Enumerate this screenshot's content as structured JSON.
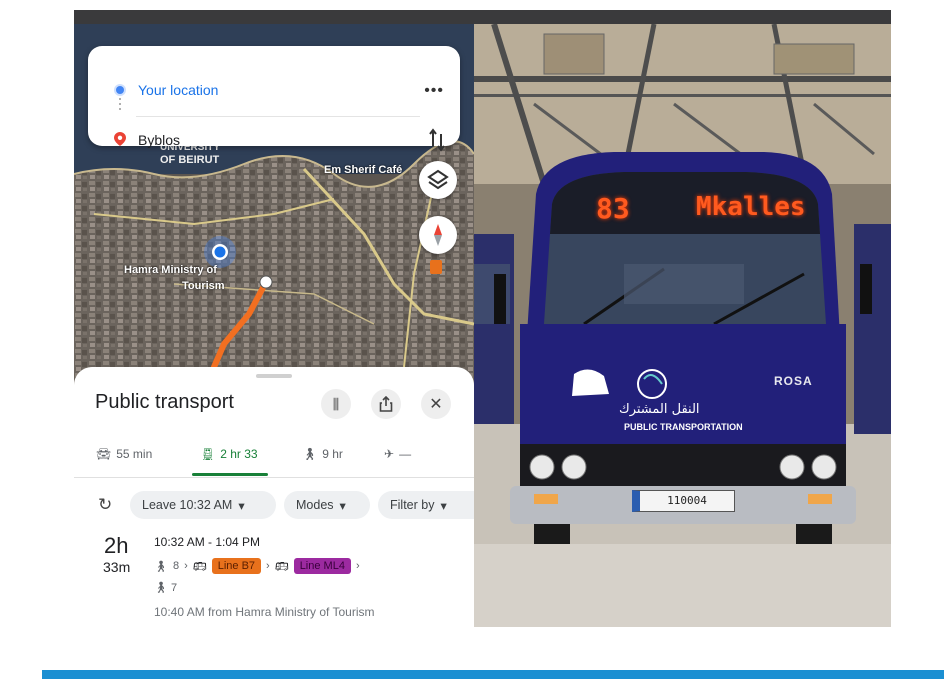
{
  "directions": {
    "origin": "Your location",
    "destination": "Byblos",
    "more_label": "•••"
  },
  "map_labels": {
    "university": "UNIVERSITY",
    "beirut": "OF BEIRUT",
    "hamra": "Hamra Ministry of",
    "tourism": "Tourism",
    "street": "Em Sherif Café"
  },
  "sheet": {
    "title": "Public transport",
    "modes": [
      {
        "icon": "car",
        "label": "55 min"
      },
      {
        "icon": "transit",
        "label": "2 hr 33"
      },
      {
        "icon": "walk",
        "label": "9 hr"
      },
      {
        "icon": "plane",
        "label": "—"
      }
    ],
    "filters": {
      "leave": "Leave 10:32 AM",
      "modes": "Modes",
      "filter_by": "Filter by"
    },
    "trip": {
      "duration_hours": "2h",
      "duration_minutes": "33m",
      "time_range": "10:32 AM - 1:04 PM",
      "walk1": "8",
      "line1": "Line B7",
      "line1_color": "#e8711c",
      "line2": "Line ML4",
      "line2_color": "#9c2aa0",
      "walk2": "7",
      "from_text": "10:40 AM from Hamra Ministry of Tourism"
    }
  },
  "bus": {
    "route_number": "83",
    "destination_sign": "Mkalles",
    "brand": "ROSA",
    "arabic_text": "النقل المشترك",
    "english_text": "PUBLIC TRANSPORTATION",
    "plate": "110004"
  },
  "colors": {
    "bus_body": "#22207a",
    "accent_bar": "#1b8fd2"
  }
}
